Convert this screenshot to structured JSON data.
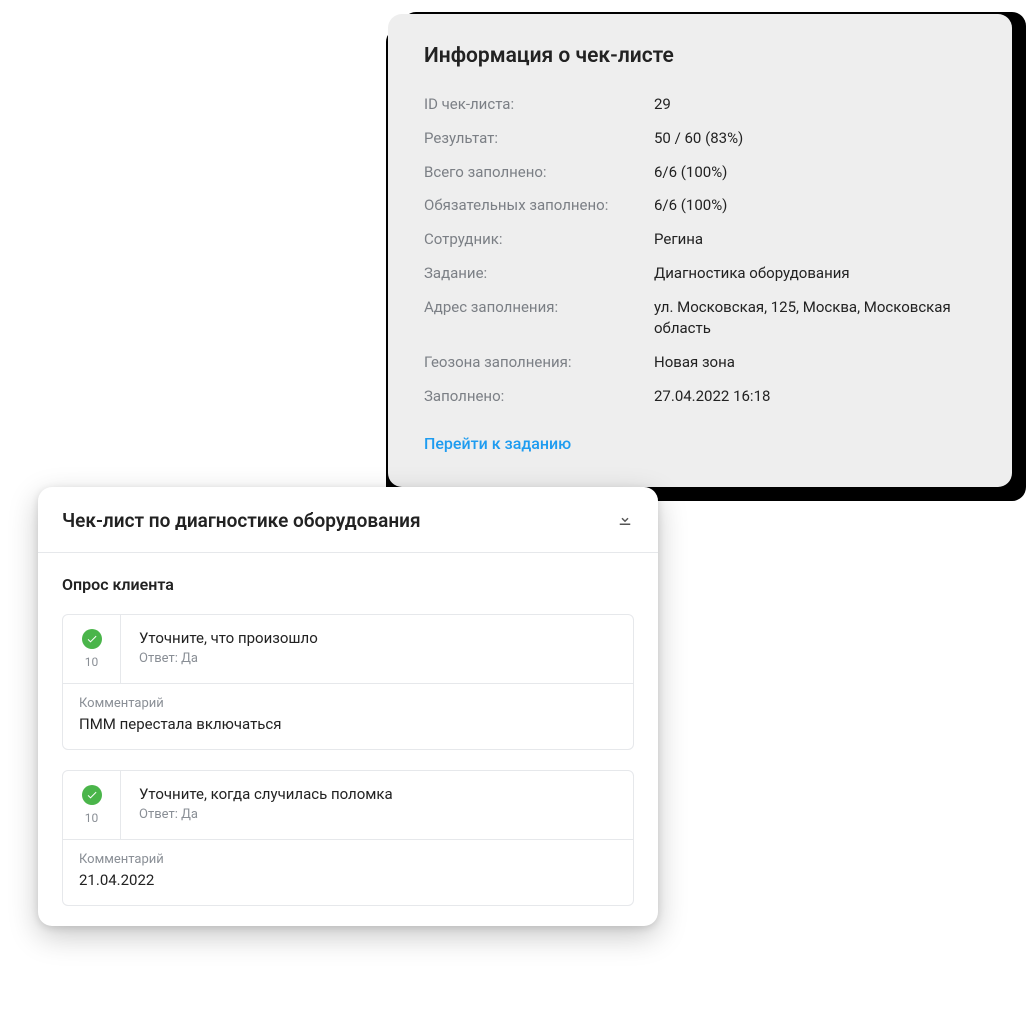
{
  "info": {
    "title": "Информация о чек-листе",
    "rows": [
      {
        "k": "ID чек-листа:",
        "v": "29"
      },
      {
        "k": "Результат:",
        "v": "50 / 60 (83%)"
      },
      {
        "k": "Всего заполнено:",
        "v": "6/6 (100%)"
      },
      {
        "k": "Обязательных заполнено:",
        "v": "6/6 (100%)"
      },
      {
        "k": "Сотрудник:",
        "v": "Регина"
      },
      {
        "k": "Задание:",
        "v": "Диагностика оборудования"
      },
      {
        "k": "Адрес заполнения:",
        "v": "ул. Московская, 125, Москва, Московская область"
      },
      {
        "k": "Геозона заполнения:",
        "v": "Новая зона"
      },
      {
        "k": "Заполнено:",
        "v": "27.04.2022 16:18"
      }
    ],
    "link": "Перейти к заданию"
  },
  "checklist": {
    "title": "Чек-лист по диагностике оборудования",
    "section": "Опрос клиента",
    "items": [
      {
        "score": "10",
        "question": "Уточните, что произошло",
        "answer": "Ответ: Да",
        "comment_label": "Комментарий",
        "comment_value": "ПММ перестала включаться"
      },
      {
        "score": "10",
        "question": "Уточните, когда случилась поломка",
        "answer": "Ответ: Да",
        "comment_label": "Комментарий",
        "comment_value": "21.04.2022"
      }
    ]
  }
}
